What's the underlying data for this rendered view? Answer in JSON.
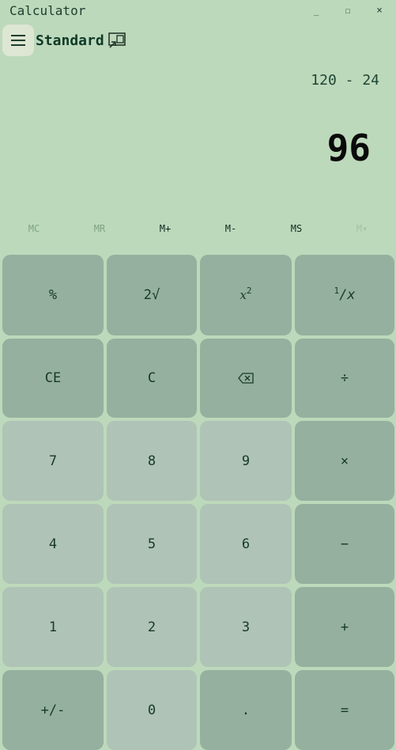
{
  "window": {
    "title": "Calculator",
    "minimize": "_",
    "maximize": "☐",
    "close": "×"
  },
  "header": {
    "mode": "Standard"
  },
  "display": {
    "expression": "120 - 24",
    "result": "96"
  },
  "memory": [
    "MC",
    "MR",
    "M+",
    "M-",
    "MS",
    "M▾"
  ],
  "keys": {
    "percent": "%",
    "sqrt": "2√",
    "square_base": "x",
    "square_exp": "2",
    "recip_num": "1",
    "recip_rest": "/x",
    "ce": "CE",
    "c": "C",
    "divide": "÷",
    "n7": "7",
    "n8": "8",
    "n9": "9",
    "multiply": "×",
    "n4": "4",
    "n5": "5",
    "n6": "6",
    "minus": "−",
    "n1": "1",
    "n2": "2",
    "n3": "3",
    "plus": "+",
    "negate": "+/-",
    "n0": "0",
    "decimal": ".",
    "equals": "="
  },
  "colors": {
    "background": "#bdd9bb",
    "function_key": "#95b09e",
    "number_key": "#afc3b6"
  }
}
